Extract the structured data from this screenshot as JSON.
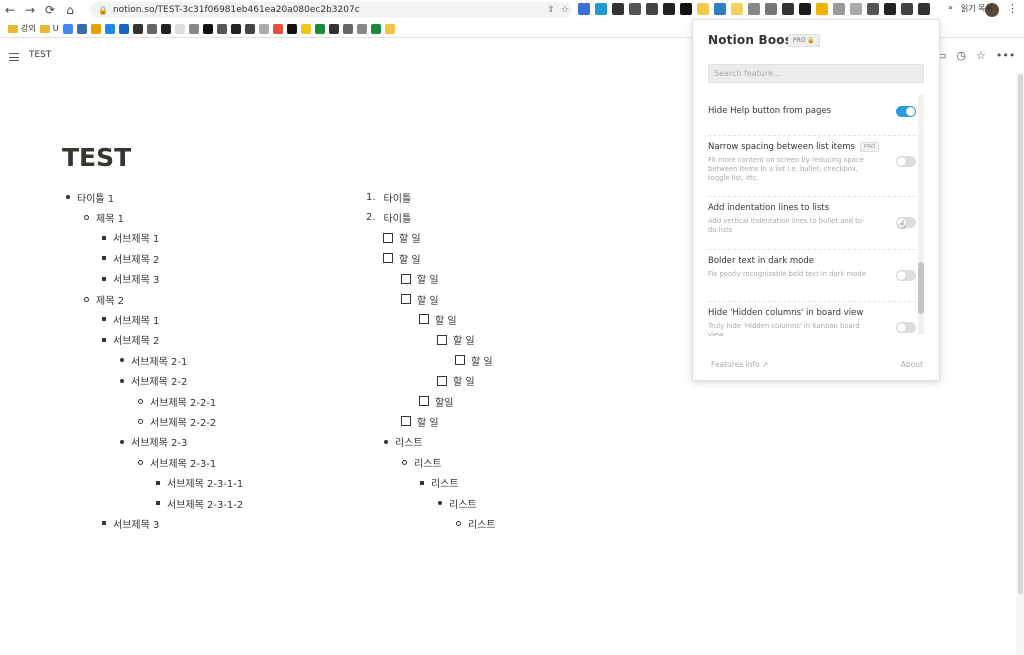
{
  "browser": {
    "url": "notion.so/TEST-3c31f06981eb461ea20a080ec2b3207c",
    "bookmarks": [
      {
        "label": "강의",
        "type": "folder"
      },
      {
        "label": "U",
        "type": "folder"
      }
    ],
    "bookmarks_right": [
      "»",
      "읽기 목록"
    ]
  },
  "notion": {
    "breadcrumb": "TEST",
    "page_title": "TEST",
    "left_list": [
      {
        "text": "타이틀 1",
        "marker": "disc",
        "level": 0
      },
      {
        "text": "제목 1",
        "marker": "circ",
        "level": 1
      },
      {
        "text": "서브제목 1",
        "marker": "sq",
        "level": 2
      },
      {
        "text": "서브제목 2",
        "marker": "sq",
        "level": 2
      },
      {
        "text": "서브제목 3",
        "marker": "sq",
        "level": 2
      },
      {
        "text": "제목 2",
        "marker": "circ",
        "level": 1
      },
      {
        "text": "서브제목 1",
        "marker": "sq",
        "level": 2
      },
      {
        "text": "서브제목 2",
        "marker": "sq",
        "level": 2
      },
      {
        "text": "서브제목 2-1",
        "marker": "disc",
        "level": 3
      },
      {
        "text": "서브제목 2-2",
        "marker": "disc",
        "level": 3
      },
      {
        "text": "서브제목 2-2-1",
        "marker": "circ",
        "level": 4
      },
      {
        "text": "서브제목 2-2-2",
        "marker": "circ",
        "level": 4
      },
      {
        "text": "서브제목 2-3",
        "marker": "disc",
        "level": 3
      },
      {
        "text": "서브제목 2-3-1",
        "marker": "circ",
        "level": 4
      },
      {
        "text": "서브제목 2-3-1-1",
        "marker": "sq",
        "level": 5
      },
      {
        "text": "서브제목 2-3-1-2",
        "marker": "sq",
        "level": 5
      },
      {
        "text": "서브제목 3",
        "marker": "sq",
        "level": 2
      }
    ],
    "right_list": [
      {
        "text": "타이틀",
        "marker": "num",
        "num": "1.",
        "level": 0
      },
      {
        "text": "타이틀",
        "marker": "num",
        "num": "2.",
        "level": 0
      },
      {
        "text": "할 일",
        "marker": "cb",
        "level": 1
      },
      {
        "text": "할 일",
        "marker": "cb",
        "level": 1
      },
      {
        "text": "할 일",
        "marker": "cb",
        "level": 2
      },
      {
        "text": "할 일",
        "marker": "cb",
        "level": 2
      },
      {
        "text": "할 일",
        "marker": "cb",
        "level": 3
      },
      {
        "text": "할 일",
        "marker": "cb",
        "level": 4
      },
      {
        "text": "할 일",
        "marker": "cb",
        "level": 5
      },
      {
        "text": "할 일",
        "marker": "cb",
        "level": 4
      },
      {
        "text": "할일",
        "marker": "cb",
        "level": 3
      },
      {
        "text": "할 일",
        "marker": "cb",
        "level": 2
      },
      {
        "text": "리스트",
        "marker": "disc",
        "level": 1
      },
      {
        "text": "리스트",
        "marker": "circ",
        "level": 2
      },
      {
        "text": "리스트",
        "marker": "sq",
        "level": 3
      },
      {
        "text": "리스트",
        "marker": "disc",
        "level": 4
      },
      {
        "text": "리스트",
        "marker": "circ",
        "level": 5
      }
    ]
  },
  "popup": {
    "title": "Notion Boost",
    "badge": "PRO 🔒",
    "search_placeholder": "Search feature...",
    "features": [
      {
        "label": "Hide Help button from pages",
        "desc": "",
        "pro": false,
        "enabled": true
      },
      {
        "label": "Narrow spacing between list items",
        "desc": "Fit more content on screen by reducing space between items in a list i.e. bullet, checkbox, toggle list, etc.",
        "pro": true,
        "pro_label": "PRO",
        "enabled": false
      },
      {
        "label": "Add indentation lines to lists",
        "desc": "Add vertical indentation lines to bullet and to-do lists",
        "pro": false,
        "enabled": false
      },
      {
        "label": "Bolder text in dark mode",
        "desc": "Fix poorly recognizable bold text in dark mode",
        "pro": false,
        "enabled": false
      },
      {
        "label": "Hide 'Hidden columns' in board view",
        "desc": "Truly hide 'Hidden columns' in Kanban board view",
        "pro": false,
        "enabled": false
      }
    ],
    "footer_left": "Features info ↗",
    "footer_right": "About"
  },
  "colors": {
    "toggle_on": "#2a9bdb",
    "text": "#37352f"
  }
}
